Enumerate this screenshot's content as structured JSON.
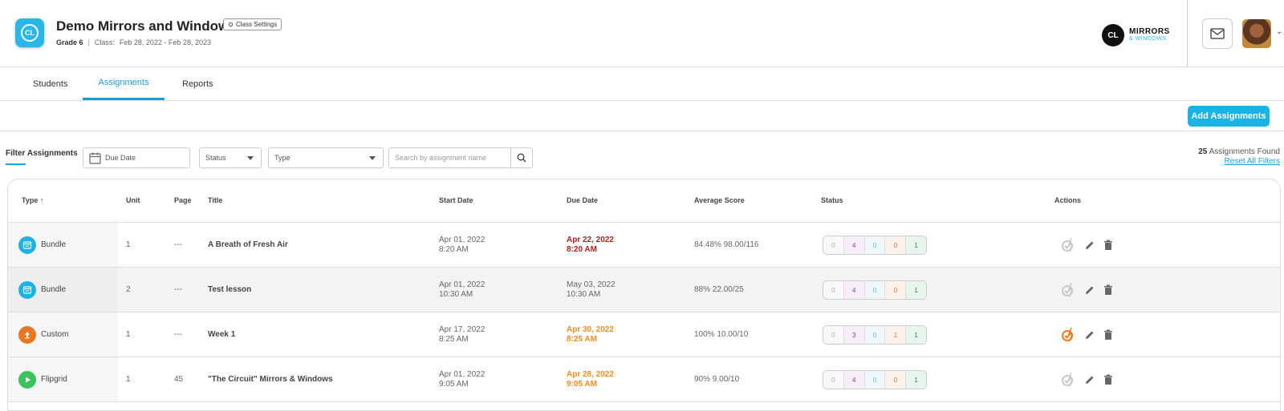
{
  "header": {
    "logo_text": "CL",
    "class_title": "Demo Mirrors and Windows",
    "class_settings_label": "Class Settings",
    "grade": "Grade 6",
    "class_label": "Class:",
    "class_range": "Feb 28, 2022  -  Feb 28, 2023",
    "brand_mark": "CL",
    "brand_line1": "MIRRORS",
    "brand_line2": "& WINDOWS"
  },
  "tabs": [
    {
      "label": "Students",
      "active": false
    },
    {
      "label": "Assignments",
      "active": true
    },
    {
      "label": "Reports",
      "active": false
    }
  ],
  "actions": {
    "add_label": "Add Assignments"
  },
  "filters": {
    "label": "Filter Assignments",
    "due_date_placeholder": "Due Date",
    "status_label": "Status",
    "type_label": "Type",
    "search_placeholder": "Search by assignment name",
    "found_count": "25",
    "found_text": "Assignments Found",
    "reset_label": "Reset All Filters"
  },
  "table": {
    "headers": {
      "type": "Type",
      "unit": "Unit",
      "page": "Page",
      "title": "Title",
      "start": "Start Date",
      "due": "Due Date",
      "avg": "Average Score",
      "status": "Status",
      "actions": "Actions"
    },
    "rows": [
      {
        "type": "Bundle",
        "unit": "1",
        "page": "---",
        "title": "A Breath of Fresh Air",
        "start_date": "Apr 01, 2022",
        "start_time": "8:20 AM",
        "due_date": "Apr 22, 2022",
        "due_time": "8:20 AM",
        "due_style": "red",
        "avg": "84.48% 98.00/116",
        "status": [
          "0",
          "4",
          "0",
          "0",
          "1"
        ],
        "icon": "bundle-icon"
      },
      {
        "type": "Bundle",
        "unit": "2",
        "page": "---",
        "title": "Test lesson",
        "start_date": "Apr 01, 2022",
        "start_time": "10:30 AM",
        "due_date": "May 03, 2022",
        "due_time": "10:30 AM",
        "due_style": "normal",
        "avg": "88% 22.00/25",
        "status": [
          "0",
          "4",
          "0",
          "0",
          "1"
        ],
        "icon": "bundle-icon"
      },
      {
        "type": "Custom",
        "unit": "1",
        "page": "---",
        "title": "Week 1",
        "start_date": "Apr 17, 2022",
        "start_time": "8:25 AM",
        "due_date": "Apr 30, 2022",
        "due_time": "8:25 AM",
        "due_style": "orange",
        "avg": "100% 10.00/10",
        "status": [
          "0",
          "3",
          "0",
          "1",
          "1"
        ],
        "icon": "custom-icon"
      },
      {
        "type": "Flipgrid",
        "unit": "1",
        "page": "45",
        "title": "\"The Circuit\" Mirrors & Windows",
        "start_date": "Apr 01, 2022",
        "start_time": "9:05 AM",
        "due_date": "Apr 28, 2022",
        "due_time": "9:05 AM",
        "due_style": "orange",
        "avg": "90% 9.00/10",
        "status": [
          "0",
          "4",
          "0",
          "0",
          "1"
        ],
        "icon": "flipgrid-icon"
      }
    ]
  },
  "colors": {
    "accent": "#1a9fd8",
    "button": "#1ab3e6",
    "due_red": "#b71c1c",
    "due_orange": "#f28c1b",
    "bundle": "#1ab3e6",
    "custom": "#e87722",
    "flipgrid": "#3cc35f"
  }
}
